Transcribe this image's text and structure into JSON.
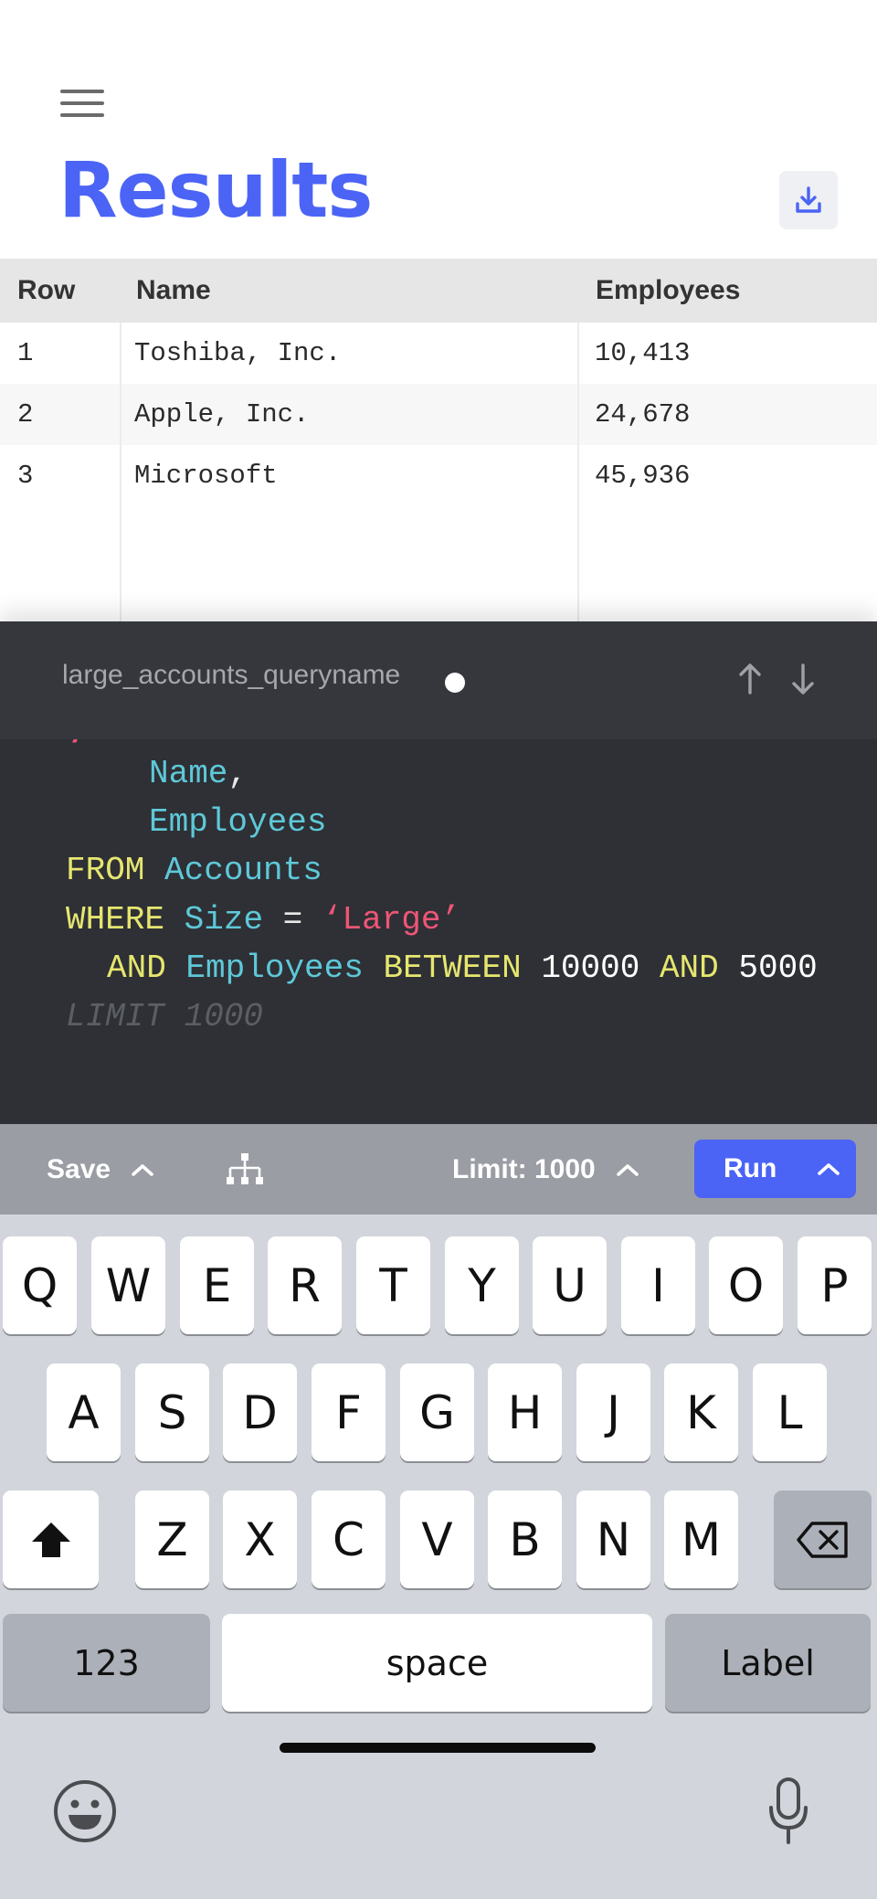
{
  "header": {
    "title": "Results"
  },
  "table": {
    "columns": [
      "Row",
      "Name",
      "Employees"
    ],
    "rows": [
      [
        "1",
        "Toshiba, Inc.",
        "10,413"
      ],
      [
        "2",
        "Apple, Inc.",
        "24,678"
      ],
      [
        "3",
        "Microsoft",
        "45,936"
      ]
    ]
  },
  "editor": {
    "query_name": "large_accounts_queryname",
    "code": {
      "l1_id": "Name",
      "l1_op": ",",
      "l2_id": "Employees",
      "l3_kw": "FROM",
      "l3_id": "Accounts",
      "l4_kw": "WHERE",
      "l4_id": "Size",
      "l4_op": "=",
      "l4_str": "‘Large’",
      "l5_kw1": "AND",
      "l5_id": "Employees",
      "l5_kw2": "BETWEEN",
      "l5_num1": "10000",
      "l5_kw3": "AND",
      "l5_num2": "5000",
      "l6_ghost": "LIMIT 1000"
    }
  },
  "toolbar": {
    "save_label": "Save",
    "limit_label": "Limit: 1000",
    "run_label": "Run"
  },
  "keyboard": {
    "row1": [
      "Q",
      "W",
      "E",
      "R",
      "T",
      "Y",
      "U",
      "I",
      "O",
      "P"
    ],
    "row2": [
      "A",
      "S",
      "D",
      "F",
      "G",
      "H",
      "J",
      "K",
      "L"
    ],
    "row3": [
      "Z",
      "X",
      "C",
      "V",
      "B",
      "N",
      "M"
    ],
    "numbers_label": "123",
    "space_label": "space",
    "return_label": "Label"
  },
  "colors": {
    "accent": "#4b64f5",
    "editor_bg": "#2e3035",
    "keyword": "#e6e66f",
    "identifier": "#5ec8d8",
    "string": "#ef5576"
  },
  "icons": [
    "hamburger-icon",
    "download-icon",
    "arrow-up-icon",
    "arrow-down-icon",
    "chevron-up-icon",
    "schema-tree-icon",
    "shift-icon",
    "backspace-icon",
    "emoji-icon",
    "microphone-icon"
  ]
}
